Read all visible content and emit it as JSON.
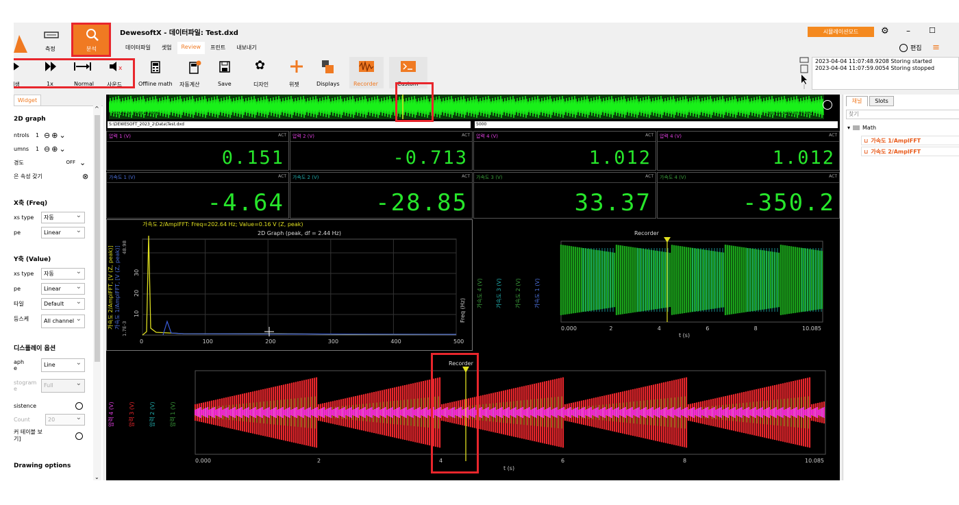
{
  "title_bar": {
    "app": "DewesoftX - 데이터파일: Test.dxd",
    "mode_badge": "시뮬레이션모드",
    "minimize": "–",
    "maximize": "☐",
    "edit_label": "편집"
  },
  "main_tabs": [
    {
      "label": "측정"
    },
    {
      "label": "분석"
    }
  ],
  "menu": [
    {
      "label": "데이터파일"
    },
    {
      "label": "셋업"
    },
    {
      "label": "Review"
    },
    {
      "label": "프린트"
    },
    {
      "label": "내보내기"
    }
  ],
  "toolbar": {
    "play": "재생",
    "speed": "1x",
    "normal": "Normal",
    "sound": "사운드",
    "offline_math": "Offline math",
    "auto_calc": "자동계산",
    "save": "Save",
    "design": "디자인",
    "widget": "위젯",
    "displays": "Displays",
    "recorder": "Recorder",
    "custom": "Custom"
  },
  "log": [
    "2023-04-04 11:07:48.9208 Storing started",
    "2023-04-04 11:07:59.0054 Storing stopped"
  ],
  "left_panel": {
    "tab": "Widget",
    "section1": "2D graph",
    "controls_label": "ntrols",
    "controls_val": "1",
    "columns_label": "umns",
    "columns_val": "1",
    "grid_label": "경도",
    "grid_val": "OFF",
    "same_props": "은 속성 갖기",
    "x_axis": "X축 (Freq)",
    "x_type_label": "xs type",
    "x_type_val": "자동",
    "x_scale_label": "pe",
    "x_scale_val": "Linear",
    "y_axis": "Y축 (Value)",
    "y_type_label": "xs type",
    "y_type_val": "자동",
    "y_scale_label": "pe",
    "y_scale_val": "Linear",
    "y_style_label": "타일",
    "y_style_val": "Default",
    "y_same_label": "등스케",
    "y_same_val": "All channel",
    "display_opts": "디스플레이 옵션",
    "graph_type_label": "aph\ne",
    "graph_type_val": "Line",
    "histogram_label": "stogram\ne",
    "histogram_val": "Full",
    "persistence": "sistence",
    "count_label": "Count",
    "count_val": "20",
    "cursor_table": "커 테이블 보\n기]",
    "drawing": "Drawing options"
  },
  "overview": {
    "start": "2023-04-04 11:07:48.9208",
    "end": "2023-04-04 11:07:59.0054"
  },
  "file_path": "S:\\DEWESOFT_2023_2\\Data\\Test.dxd",
  "rate_field": "5000",
  "meters_row1": [
    {
      "label": "압력 1 (V)",
      "value": "0.151",
      "color": "#e040e0"
    },
    {
      "label": "압력 2 (V)",
      "value": "-0.713",
      "color": "#e040e0"
    },
    {
      "label": "압력 4 (V)",
      "value": "1.012",
      "color": "#e040e0"
    },
    {
      "label": "압력 4 (V)",
      "value": "1.012",
      "color": "#e040e0"
    }
  ],
  "meters_row2": [
    {
      "label": "가속도 1 (V)",
      "value": "-4.64",
      "color": "#4b6fd8"
    },
    {
      "label": "가속도 2 (V)",
      "value": "-28.85",
      "color": "#21a8a8"
    },
    {
      "label": "가속도 3 (V)",
      "value": "33.37",
      "color": "#3a9a3a"
    },
    {
      "label": "가속도 4 (V)",
      "value": "-350.2",
      "color": "#3a9a3a"
    }
  ],
  "act": "ACT",
  "graph2d": {
    "cursor": "가속도 2/AmplFFT: Freq=202.64 Hz; Value=0.16 V (Z, peak)",
    "subtitle": "2D Graph (peak, df = 2.44 Hz)",
    "xlabel": "Freq (Hz)",
    "xticks": [
      "0",
      "100",
      "200",
      "300",
      "400",
      "500"
    ],
    "ylab1": "가속도 2/AmplFFT, [V (Z, peak)]",
    "ylab2": "가속도 1/AmplFFT, [V (Z, peak)]",
    "ymax": "48.98",
    "ymin": "1.7E-3",
    "yticks": [
      "10",
      "20",
      "30"
    ]
  },
  "recorder1": {
    "title": "Recorder",
    "xlabel": "t (s)",
    "xticks": [
      "0.000",
      "2",
      "4",
      "6",
      "8",
      "10.085"
    ],
    "channels": [
      "가속도 4 (V)",
      "가속도 3 (V)",
      "가속도 2 (V)",
      "가속도 1 (V)"
    ]
  },
  "recorder2": {
    "title": "Recorder",
    "xlabel": "t (s)",
    "xticks": [
      "0.000",
      "2",
      "4",
      "6",
      "8",
      "10.085"
    ],
    "channels": [
      "압력 4 (V)",
      "압력 3 (V)",
      "압력 2 (V)",
      "압력 1 (V)"
    ]
  },
  "right_panel": {
    "tab1": "채널",
    "tab2": "Slots",
    "search": "찾기",
    "group": "Math",
    "items": [
      "가속도 1/AmplFFT",
      "가속도 2/AmplFFT"
    ]
  },
  "colors": {
    "accent": "#f07a22",
    "badge": "#f4891f",
    "red_box": "#e8262c",
    "meter_green": "#27e62b"
  }
}
